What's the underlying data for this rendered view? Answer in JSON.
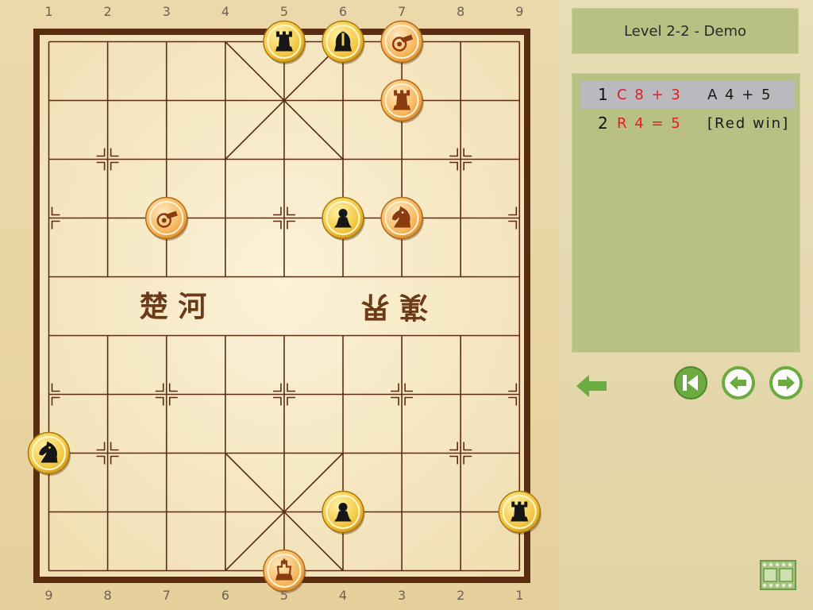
{
  "board": {
    "file_labels_top": [
      "1",
      "2",
      "3",
      "4",
      "5",
      "6",
      "7",
      "8",
      "9"
    ],
    "file_labels_bottom": [
      "9",
      "8",
      "7",
      "6",
      "5",
      "4",
      "3",
      "2",
      "1"
    ],
    "river_left": "楚 河",
    "river_right": "漢 界"
  },
  "pieces": [
    {
      "side": "black",
      "type": "rook",
      "icon": "black-rook-icon",
      "file": 4,
      "rank": 0
    },
    {
      "side": "black",
      "type": "advisor",
      "icon": "black-advisor-icon",
      "file": 5,
      "rank": 0
    },
    {
      "side": "red",
      "type": "cannon",
      "icon": "red-cannon-icon",
      "file": 6,
      "rank": 0
    },
    {
      "side": "red",
      "type": "rook",
      "icon": "red-rook-icon",
      "file": 6,
      "rank": 1
    },
    {
      "side": "red",
      "type": "cannon",
      "icon": "red-cannon-icon",
      "file": 2,
      "rank": 3
    },
    {
      "side": "black",
      "type": "pawn",
      "icon": "black-pawn-icon",
      "file": 5,
      "rank": 3
    },
    {
      "side": "red",
      "type": "horse",
      "icon": "red-horse-icon",
      "file": 6,
      "rank": 3
    },
    {
      "side": "black",
      "type": "horse",
      "icon": "black-horse-icon",
      "file": 0,
      "rank": 7
    },
    {
      "side": "black",
      "type": "pawn",
      "icon": "black-pawn-icon",
      "file": 5,
      "rank": 8
    },
    {
      "side": "black",
      "type": "rook",
      "icon": "black-rook-icon",
      "file": 8,
      "rank": 8
    },
    {
      "side": "red",
      "type": "king",
      "icon": "red-king-icon",
      "file": 4,
      "rank": 9
    }
  ],
  "panel": {
    "title": "Level 2-2 - Demo",
    "moves": [
      {
        "num": "1",
        "red": "C 8 + 3",
        "black": "A 4 + 5",
        "selected": true
      },
      {
        "num": "2",
        "red": "R 4 = 5",
        "black": "[Red win]",
        "selected": false
      }
    ]
  },
  "colors": {
    "panel_green": "#b9c084",
    "button_green": "#6cab3f",
    "red_move_text": "#e02020",
    "board_line": "#5a2d12"
  },
  "icons": {
    "back": "arrow-left-icon",
    "first": "skip-to-start-icon",
    "prev": "circle-arrow-left-icon",
    "next": "circle-arrow-right-icon",
    "film": "film-strip-icon"
  }
}
